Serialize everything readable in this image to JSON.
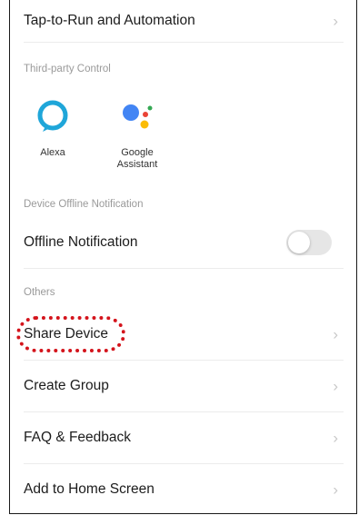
{
  "top_row": {
    "label": "Tap-to-Run and Automation"
  },
  "third_party": {
    "header": "Third-party Control",
    "items": [
      {
        "name": "Alexa",
        "icon": "alexa-icon"
      },
      {
        "name": "Google Assistant",
        "icon": "google-assistant-icon"
      }
    ]
  },
  "offline": {
    "header": "Device Offline Notification",
    "label": "Offline Notification",
    "toggle_on": false
  },
  "others": {
    "header": "Others",
    "items": [
      {
        "label": "Share Device"
      },
      {
        "label": "Create Group"
      },
      {
        "label": "FAQ & Feedback"
      },
      {
        "label": "Add to Home Screen"
      }
    ]
  },
  "colors": {
    "highlight": "#d4141c",
    "alexa": "#1fa6d9",
    "chevron": "#c8c8c8"
  }
}
